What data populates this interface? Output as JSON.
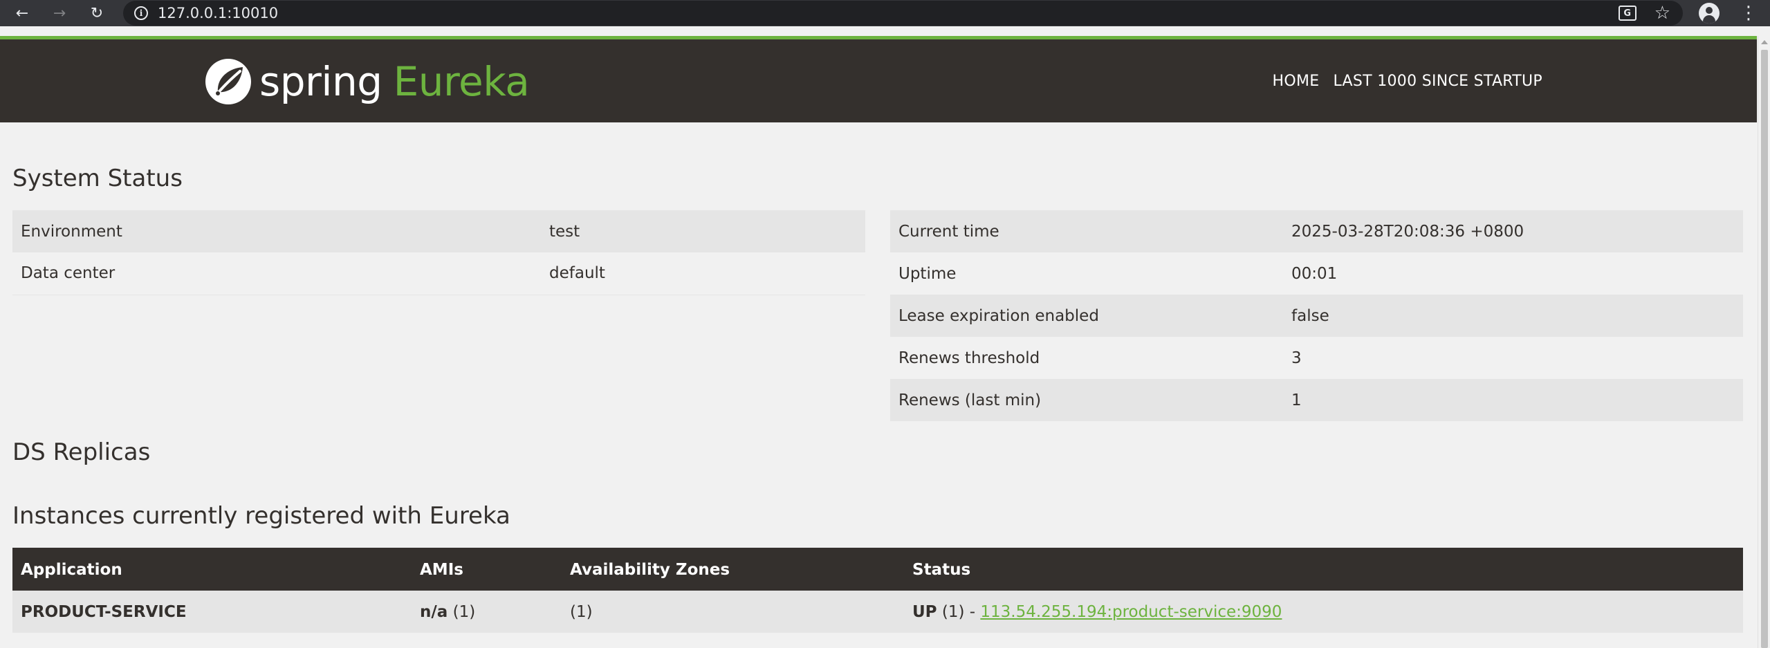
{
  "browser": {
    "url": "127.0.0.1:10010"
  },
  "header": {
    "logo_spring": "spring",
    "logo_eureka": "Eureka",
    "nav": [
      "HOME",
      "LAST 1000 SINCE STARTUP"
    ]
  },
  "system_status": {
    "title": "System Status",
    "left": [
      {
        "label": "Environment",
        "value": "test"
      },
      {
        "label": "Data center",
        "value": "default"
      }
    ],
    "right": [
      {
        "label": "Current time",
        "value": "2025-03-28T20:08:36 +0800"
      },
      {
        "label": "Uptime",
        "value": "00:01"
      },
      {
        "label": "Lease expiration enabled",
        "value": "false"
      },
      {
        "label": "Renews threshold",
        "value": "3"
      },
      {
        "label": "Renews (last min)",
        "value": "1"
      }
    ]
  },
  "ds_replicas": {
    "title": "DS Replicas"
  },
  "instances": {
    "title": "Instances currently registered with Eureka",
    "columns": [
      "Application",
      "AMIs",
      "Availability Zones",
      "Status"
    ],
    "rows": [
      {
        "application": "PRODUCT-SERVICE",
        "amis_bold": "n/a",
        "amis_count": " (1)",
        "zones": "(1)",
        "status_bold": "UP",
        "status_count": " (1) - ",
        "instance_link": "113.54.255.194:product-service:9090"
      }
    ]
  },
  "colors": {
    "brand_green": "#6db33f",
    "header_dark": "#34302d",
    "page_bg": "#f1f1f1",
    "row_alt": "#e5e5e5"
  }
}
